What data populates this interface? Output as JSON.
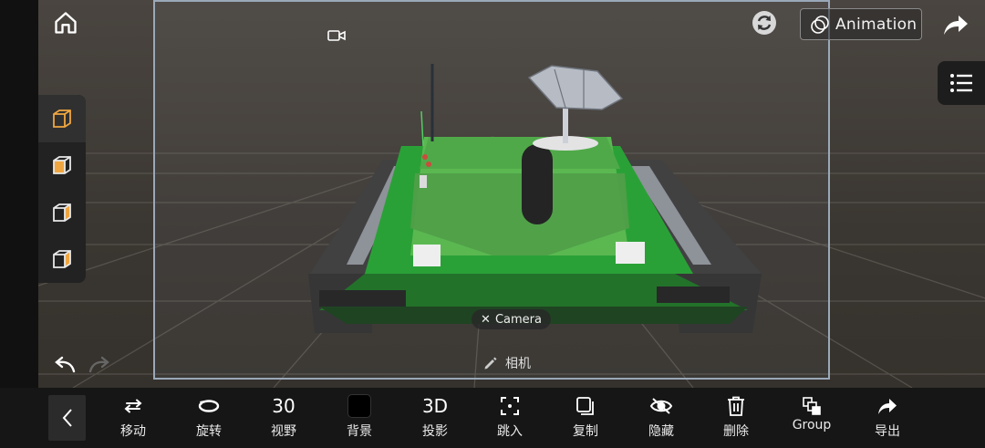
{
  "header": {
    "animation_label": "Animation"
  },
  "icons": {
    "home": "home-icon",
    "camera": "video-camera-icon",
    "reset": "refresh-icon",
    "share": "share-icon",
    "list": "list-icon"
  },
  "camera_chip": {
    "close_glyph": "✕",
    "label": "Camera"
  },
  "camera_name": {
    "label": "相机"
  },
  "toolbar": {
    "items": [
      {
        "label": "移动",
        "icon": "move-arrows-icon"
      },
      {
        "label": "旋转",
        "icon": "rotate-icon"
      },
      {
        "value": "30",
        "label": "视野"
      },
      {
        "label": "背景",
        "icon": "background-swatch-icon",
        "color": "#000000"
      },
      {
        "value": "3D",
        "label": "投影"
      },
      {
        "label": "跳入",
        "icon": "focus-icon"
      },
      {
        "label": "复制",
        "icon": "copy-icon"
      },
      {
        "label": "隐藏",
        "icon": "eye-off-icon"
      },
      {
        "label": "删除",
        "icon": "trash-icon"
      },
      {
        "label": "Group",
        "icon": "group-icon"
      },
      {
        "label": "导出",
        "icon": "export-icon"
      }
    ]
  },
  "colors": {
    "toolbar_bg": "#161616",
    "tank_green": "#1f8a2a",
    "frame_border": "#9aa8b8"
  }
}
